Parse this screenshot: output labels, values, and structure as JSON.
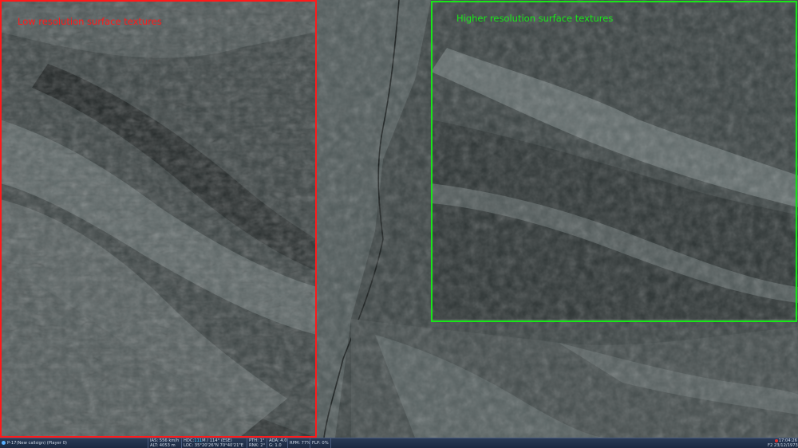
{
  "overlays": {
    "low_res": {
      "label": "Low resolution surface textures",
      "color": "#ff1a1a"
    },
    "high_res": {
      "label": "Higher resolution surface textures",
      "color": "#19e619"
    }
  },
  "status_bar": {
    "callsign": "P-17(New callsign) (Player 0)",
    "ias": "IAS:    556 km/h",
    "alt": "ALT:    4053 m",
    "hdg_prefix": "HDC:",
    "hdg_value": "111",
    "hdg_suffix": "M / 114° (ESE)",
    "loc": "LOC: 35°20'26\"N 70°40'21\"E",
    "pth": "PTH: 1°",
    "rnk": "RNK: 2°",
    "aoa": "AOA: 4.0°",
    "g": "G: 1.0",
    "rpm": "RPM: 77%",
    "flp": "FLP: 0%",
    "time": "17:04:26",
    "date": "F2 23/12/1973"
  }
}
